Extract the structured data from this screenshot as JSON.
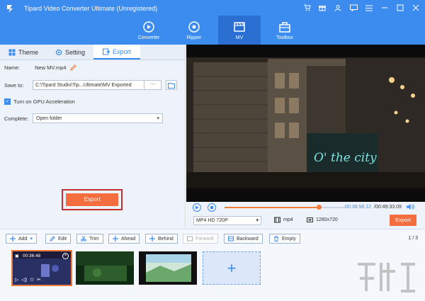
{
  "app": {
    "title": "Tipard Video Converter Ultimate (Unregistered)"
  },
  "window_icons": [
    "cart-icon",
    "gift-icon",
    "user-icon",
    "chat-icon",
    "menu-icon",
    "minimize-icon",
    "maximize-icon",
    "close-icon"
  ],
  "nav": [
    {
      "label": "Converter",
      "icon": "converter-icon",
      "active": false
    },
    {
      "label": "Ripper",
      "icon": "ripper-icon",
      "active": false
    },
    {
      "label": "MV",
      "icon": "mv-icon",
      "active": true
    },
    {
      "label": "Toolbox",
      "icon": "toolbox-icon",
      "active": false
    }
  ],
  "tabs": [
    {
      "label": "Theme",
      "icon": "theme-icon"
    },
    {
      "label": "Setting",
      "icon": "setting-icon"
    },
    {
      "label": "Export",
      "icon": "export-icon",
      "active": true
    }
  ],
  "export_panel": {
    "name_label": "Name:",
    "name_value": "New MV.mp4",
    "save_label": "Save to:",
    "save_path": "C:\\Tipard Studio\\Tip...Ultimate\\MV Exported",
    "save_browse": "···",
    "gpu_label": "Turn on GPU Acceleration",
    "complete_label": "Complete:",
    "complete_value": "Open folder",
    "export_button": "Export"
  },
  "player": {
    "sign_text": "O' the city",
    "time_current": "00:38:58.12",
    "time_total": "/00:49:33.09",
    "progress": 0.78,
    "format": "MP4 HD 720P",
    "container": "mp4",
    "resolution": "1280x720",
    "export_button": "Export"
  },
  "toolbar": {
    "add": "Add",
    "edit": "Edit",
    "trim": "Trim",
    "ahead": "Ahead",
    "behind": "Behind",
    "forward": "Forward",
    "backward": "Backward",
    "empty": "Empty",
    "page": "1 / 3"
  },
  "timeline": {
    "clips": [
      {
        "time": "00:36:48",
        "selected": true
      },
      {
        "time": "",
        "selected": false
      },
      {
        "time": "",
        "selected": false
      }
    ]
  },
  "colors": {
    "brand": "#3c8cf0",
    "accent": "#f36d3e",
    "nav_active": "#2b6fd2"
  }
}
